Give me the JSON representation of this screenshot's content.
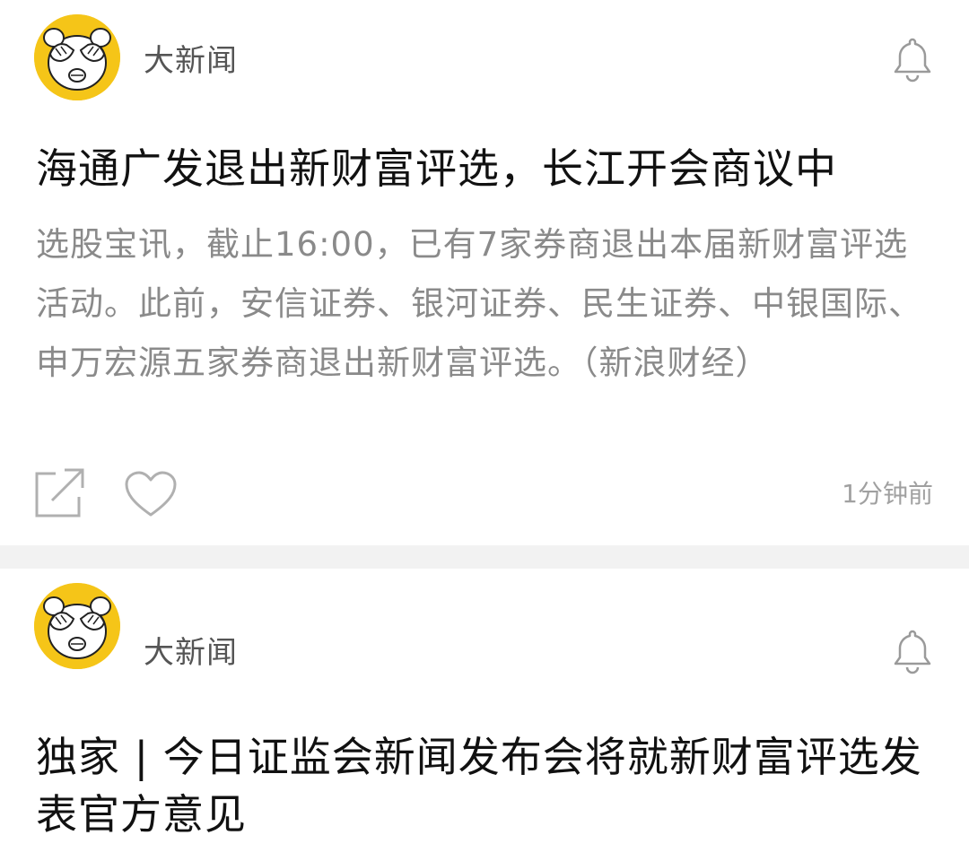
{
  "feed": {
    "items": [
      {
        "source": "大新闻",
        "icons": {
          "avatar": "cover-eyes-face-icon",
          "follow": "bell-icon",
          "share": "share-icon",
          "like": "heart-icon"
        },
        "headline": "海通广发退出新财富评选，长江开会商议中",
        "summary": "选股宝讯，截止16:00，已有7家券商退出本届新财富评选活动。此前，安信证券、银河证券、民生证券、中银国际、申万宏源五家券商退出新财富评选。（新浪财经）",
        "time": "1分钟前"
      },
      {
        "source": "大新闻",
        "icons": {
          "avatar": "cover-eyes-face-icon",
          "follow": "bell-icon"
        },
        "headline": "独家 | 今日证监会新闻发布会将就新财富评选发表官方意见"
      }
    ]
  },
  "colors": {
    "avatar_bg": "#f5c518",
    "separator": "#f2f2f2",
    "summary_text": "#8a8a8a",
    "meta_text": "#a0a0a0"
  }
}
